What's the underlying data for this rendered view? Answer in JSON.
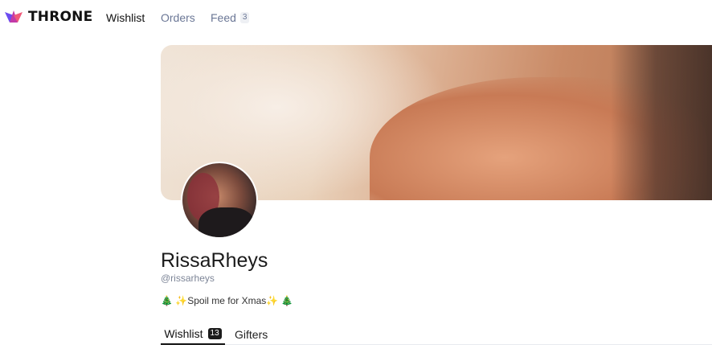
{
  "brand": {
    "name": "THRONE",
    "logo_icon": "crown-logo-icon",
    "colors": [
      "#6c4cf0",
      "#c23aa8",
      "#f05a7a"
    ]
  },
  "nav": {
    "wishlist": "Wishlist",
    "orders": "Orders",
    "feed": "Feed",
    "feed_count": "3"
  },
  "profile": {
    "name": "RissaRheys",
    "handle": "@rissarheys",
    "bio": "🎄 ✨Spoil me for Xmas✨ 🎄"
  },
  "tabs": {
    "wishlist": "Wishlist",
    "wishlist_count": "13",
    "gifters": "Gifters"
  }
}
